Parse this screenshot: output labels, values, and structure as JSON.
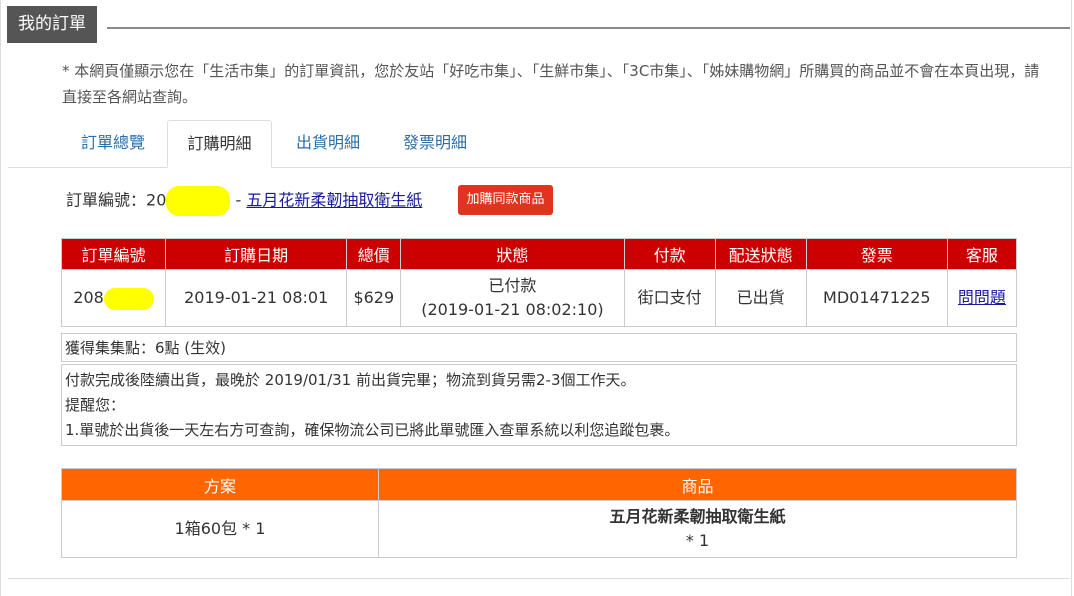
{
  "header": {
    "title": "我的訂單"
  },
  "notice": "* 本網頁僅顯示您在「生活市集」的訂單資訊，您於友站「好吃市集」、「生鮮市集」、「3C市集」、「姊妹購物網」所購買的商品並不會在本頁出現，請直接至各網站查詢。",
  "tabs": [
    {
      "label": "訂單總覽"
    },
    {
      "label": "訂購明細",
      "active": true
    },
    {
      "label": "出貨明細"
    },
    {
      "label": "發票明細"
    }
  ],
  "order": {
    "number_label": "訂單編號：",
    "number_prefix": "20",
    "separator": " - ",
    "product_link": "五月花新柔韌抽取衛生紙",
    "rebuy_button": "加購同款商品"
  },
  "order_table": {
    "headers": [
      "訂單編號",
      "訂購日期",
      "總價",
      "狀態",
      "付款",
      "配送狀態",
      "發票",
      "客服"
    ],
    "row": {
      "order_no_prefix": "208",
      "date": "2019-01-21 08:01",
      "total": "$629",
      "status": "已付款",
      "status_time": "(2019-01-21 08:02:10)",
      "payment": "街口支付",
      "delivery": "已出貨",
      "invoice": "MD01471225",
      "service_link": "問問題"
    }
  },
  "points": "獲得集集點：6點 (生效)",
  "shipping_notes": [
    "付款完成後陸續出貨，最晚於 2019/01/31 前出貨完畢；物流到貨另需2-3個工作天。",
    "提醒您：",
    "1.單號於出貨後一天左右方可查詢，確保物流公司已將此單號匯入查單系統以利您追蹤包裹。"
  ],
  "plan_table": {
    "headers": [
      "方案",
      "商品"
    ],
    "row": {
      "plan": "1箱60包 * 1",
      "product": "五月花新柔韌抽取衛生紙",
      "qty": "* 1"
    }
  },
  "colors": {
    "order_header": "#cc0000",
    "plan_header": "#ff6600",
    "rebuy_button": "#e0341e",
    "link": "#1a1a9a",
    "tab_link": "#2d6ea6",
    "redaction": "#ffff00"
  }
}
